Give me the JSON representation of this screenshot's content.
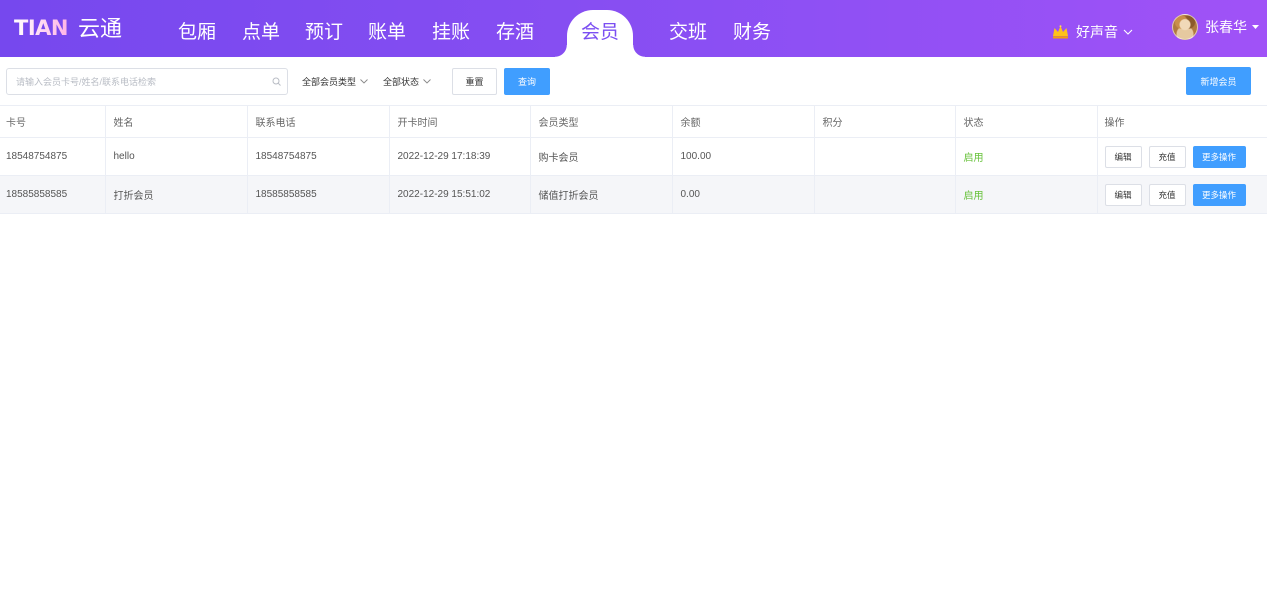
{
  "app": {
    "logo_text": "TIAN",
    "name": "云通"
  },
  "nav": {
    "items": [
      {
        "label": "包厢",
        "active": false
      },
      {
        "label": "点单",
        "active": false
      },
      {
        "label": "预订",
        "active": false
      },
      {
        "label": "账单",
        "active": false
      },
      {
        "label": "挂账",
        "active": false
      },
      {
        "label": "存酒",
        "active": false
      },
      {
        "label": "会员",
        "active": true
      },
      {
        "label": "交班",
        "active": false
      },
      {
        "label": "财务",
        "active": false
      }
    ]
  },
  "header_right": {
    "store_name": "好声音",
    "store_icon": "crown-icon",
    "user_name": "张春华",
    "user_icon": "avatar"
  },
  "toolbar": {
    "search_placeholder": "请输入会员卡号/姓名/联系电话检索",
    "search_value": "",
    "member_type_filter": "全部会员类型",
    "status_filter": "全部状态",
    "reset_label": "重置",
    "query_label": "查询",
    "add_label": "新增会员"
  },
  "table": {
    "columns": [
      "卡号",
      "姓名",
      "联系电话",
      "开卡时间",
      "会员类型",
      "余额",
      "积分",
      "状态",
      "操作"
    ],
    "rows": [
      {
        "card_no": "18548754875",
        "name": "hello",
        "phone": "18548754875",
        "opened_at": "2022-12-29 17:18:39",
        "member_type": "购卡会员",
        "balance": "100.00",
        "points": "",
        "status": "启用"
      },
      {
        "card_no": "18585858585",
        "name": "打折会员",
        "phone": "18585858585",
        "opened_at": "2022-12-29 15:51:02",
        "member_type": "储值打折会员",
        "balance": "0.00",
        "points": "",
        "status": "启用"
      }
    ],
    "row_actions": {
      "edit": "编辑",
      "recharge": "充值",
      "more": "更多操作"
    }
  },
  "colors": {
    "header-start": "#7648ee",
    "header-end": "#a052f7",
    "accent": "#7b4ef2",
    "primary": "#409eff",
    "enabled": "#67c23a",
    "stripe": "#f5f6f9"
  }
}
